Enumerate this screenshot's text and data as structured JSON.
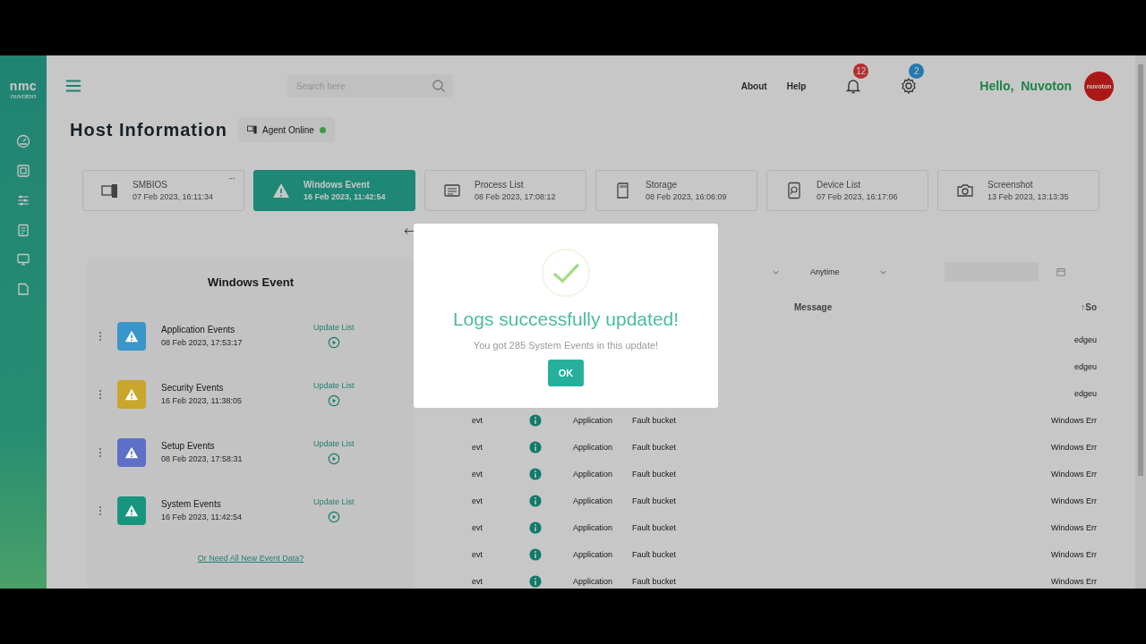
{
  "sidebar": {
    "logo": "nmc",
    "logo_sub": "nuvoton",
    "items": [
      {
        "kind": "dashboard"
      },
      {
        "kind": "chip"
      },
      {
        "kind": "sliders"
      },
      {
        "kind": "clipboard"
      },
      {
        "kind": "monitor"
      },
      {
        "kind": "note"
      }
    ]
  },
  "topbar": {
    "search": {
      "placeholder": "Search here"
    },
    "links": [
      "About",
      "Help"
    ],
    "notifications": "12",
    "settings": "2",
    "greeting": "Hello,  Nuvoton",
    "avatar": "nuvoton"
  },
  "page": {
    "title": "Host Information",
    "agent_status": "Agent Online"
  },
  "tabs": [
    {
      "kind": "server",
      "label": "SMBIOS",
      "time": "07 Feb 2023, 16:11:34",
      "selected": false,
      "menu": "···"
    },
    {
      "kind": "warning",
      "label": "Windows Event",
      "time": "16 Feb 2023, 11:42:54",
      "selected": true
    },
    {
      "kind": "list",
      "label": "Process List",
      "time": "08 Feb 2023, 17:08:12",
      "selected": false
    },
    {
      "kind": "card",
      "label": "Storage",
      "time": "08 Feb 2023, 16:06:09",
      "selected": false
    },
    {
      "kind": "device",
      "label": "Device List",
      "time": "07 Feb 2023, 16:17:06",
      "selected": false
    },
    {
      "kind": "camera",
      "label": "Screenshot",
      "time": "13 Feb 2023, 13:13:35",
      "selected": false
    }
  ],
  "event_panel": {
    "title": "Windows Event",
    "items": [
      {
        "name": "Application Events",
        "time": "08 Feb 2023, 17:53:17",
        "color": "#3a96c9",
        "action": "Update List"
      },
      {
        "name": "Security Events",
        "time": "16 Feb 2023, 11:38:05",
        "color": "#c9a62c",
        "action": "Update List"
      },
      {
        "name": "Setup Events",
        "time": "08 Feb 2023, 17:58:31",
        "color": "#5d6fc7",
        "action": "Update List"
      },
      {
        "name": "System Events",
        "time": "16 Feb 2023, 11:42:54",
        "color": "#17957f",
        "action": "Update List"
      }
    ],
    "link": "Or Need All New Event Data?"
  },
  "filters": {
    "time": "Anytime"
  },
  "table": {
    "columns": [
      {
        "label": "Message"
      },
      {
        "label": "↑So"
      }
    ],
    "rows": [
      {
        "source": "edgeu"
      },
      {
        "source": "edgeu"
      },
      {
        "source": "edgeu"
      },
      {
        "column_1": "evt",
        "column_3": "Application",
        "column_4": "Fault bucket",
        "source": "Windows Err"
      },
      {
        "column_1": "evt",
        "column_3": "Application",
        "column_4": "Fault bucket",
        "source": "Windows Err"
      },
      {
        "column_1": "evt",
        "column_3": "Application",
        "column_4": "Fault bucket",
        "source": "Windows Err"
      },
      {
        "column_1": "evt",
        "column_3": "Application",
        "column_4": "Fault bucket",
        "source": "Windows Err"
      },
      {
        "column_1": "evt",
        "column_3": "Application",
        "column_4": "Fault bucket",
        "source": "Windows Err"
      },
      {
        "column_1": "evt",
        "column_3": "Application",
        "column_4": "Fault bucket",
        "source": "Windows Err"
      },
      {
        "column_1": "evt",
        "column_3": "Application",
        "column_4": "Fault bucket",
        "source": "Windows Err"
      }
    ]
  },
  "dialog": {
    "title": "Logs successfully updated!",
    "message": "You got 285 System Events in this update!",
    "button": "OK"
  }
}
